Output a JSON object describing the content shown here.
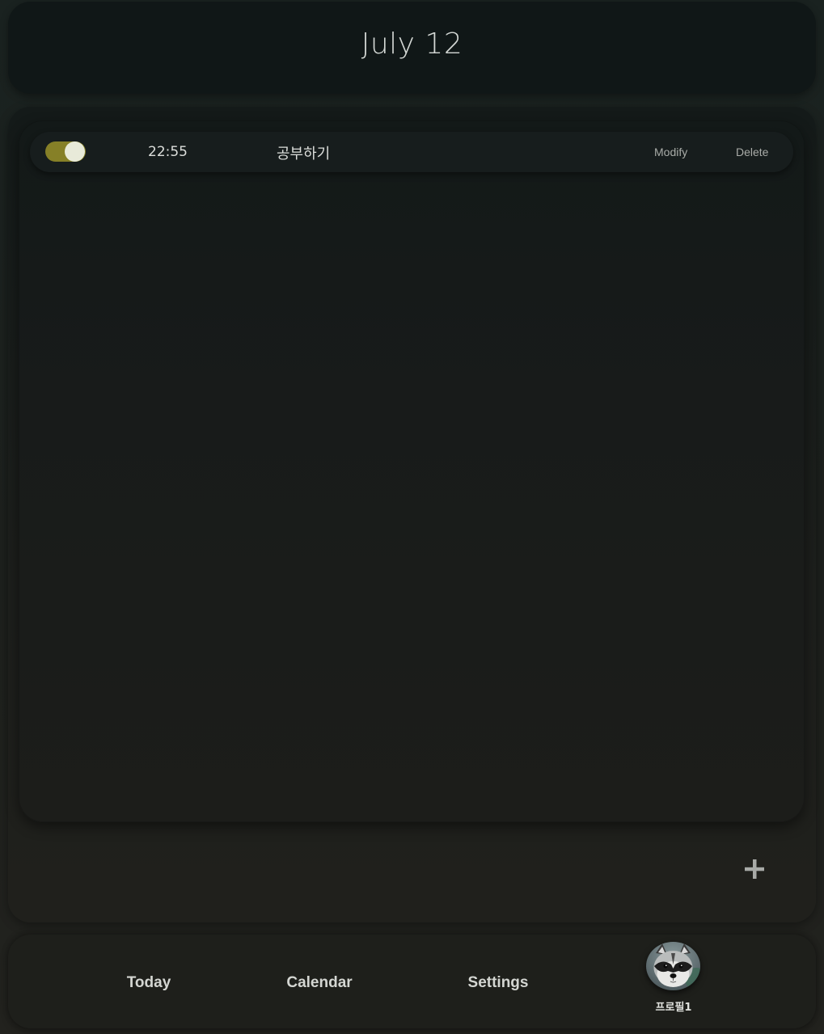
{
  "header": {
    "date": "July 12"
  },
  "todos": [
    {
      "enabled": true,
      "time": "22:55",
      "title": "공부하기",
      "modify_label": "Modify",
      "delete_label": "Delete"
    }
  ],
  "add_button": {
    "icon": "plus-icon"
  },
  "nav": {
    "today_label": "Today",
    "calendar_label": "Calendar",
    "settings_label": "Settings",
    "profile_name": "프로필1"
  },
  "colors": {
    "toggle_on": "#868027",
    "toggle_knob": "#e8ead9"
  }
}
